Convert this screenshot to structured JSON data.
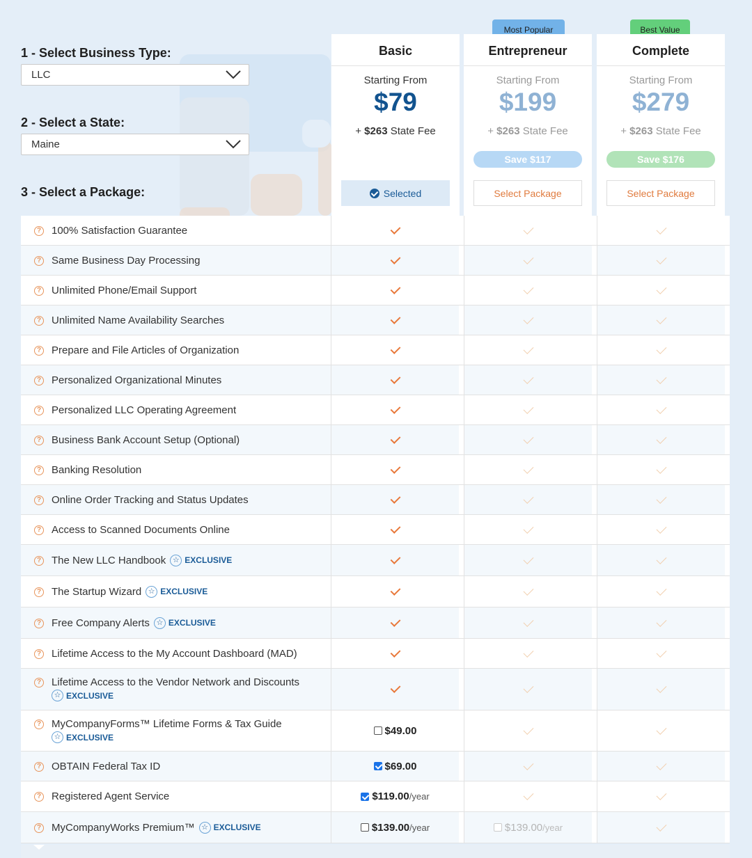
{
  "steps": {
    "business_type_label": "1 - Select Business Type:",
    "business_type_value": "LLC",
    "state_label": "2 - Select a State:",
    "state_value": "Maine",
    "package_label": "3 - Select a Package:"
  },
  "packages": [
    {
      "name": "Basic",
      "starting": "Starting From",
      "price": "$79",
      "fee_prefix": "+ ",
      "fee_amount": "$263",
      "fee_suffix": " State Fee",
      "button": "Selected",
      "badge": "",
      "save": ""
    },
    {
      "name": "Entrepreneur",
      "starting": "Starting From",
      "price": "$199",
      "fee_prefix": "+ ",
      "fee_amount": "$263",
      "fee_suffix": " State Fee",
      "button": "Select Package",
      "badge": "Most Popular",
      "save": "Save $117"
    },
    {
      "name": "Complete",
      "starting": "Starting From",
      "price": "$279",
      "fee_prefix": "+ ",
      "fee_amount": "$263",
      "fee_suffix": " State Fee",
      "button": "Select Package",
      "badge": "Best Value",
      "save": "Save $176"
    }
  ],
  "exclusive_label": "EXCLUSIVE",
  "features": [
    {
      "label": "100% Satisfaction Guarantee"
    },
    {
      "label": "Same Business Day Processing"
    },
    {
      "label": "Unlimited Phone/Email Support"
    },
    {
      "label": "Unlimited Name Availability Searches"
    },
    {
      "label": "Prepare and File Articles of Organization"
    },
    {
      "label": "Personalized Organizational Minutes"
    },
    {
      "label": "Personalized LLC Operating Agreement"
    },
    {
      "label": "Business Bank Account Setup (Optional)"
    },
    {
      "label": "Banking Resolution"
    },
    {
      "label": "Online Order Tracking and Status Updates"
    },
    {
      "label": "Access to Scanned Documents Online"
    },
    {
      "label": "The New LLC Handbook"
    },
    {
      "label": "The Startup Wizard"
    },
    {
      "label": "Free Company Alerts"
    },
    {
      "label": "Lifetime Access to the My Account Dashboard (MAD)"
    },
    {
      "label": "Lifetime Access to the Vendor Network and Discounts"
    },
    {
      "label": "MyCompanyForms™ Lifetime Forms & Tax Guide",
      "basic_price": "$49.00",
      "basic_per": "",
      "basic_checked": false
    },
    {
      "label": "OBTAIN Federal Tax ID",
      "basic_price": "$69.00",
      "basic_per": "",
      "basic_checked": true
    },
    {
      "label": "Registered Agent Service",
      "basic_price": "$119.00",
      "basic_per": "/year",
      "basic_checked": true
    },
    {
      "label": "MyCompanyWorks Premium™",
      "basic_price": "$139.00",
      "basic_per": "/year",
      "basic_checked": false,
      "ent_price": "$139.00",
      "ent_per": "/year"
    }
  ],
  "colors": {
    "accent": "#e8783a",
    "brand": "#12538f",
    "page_bg": "#e4eef8"
  }
}
